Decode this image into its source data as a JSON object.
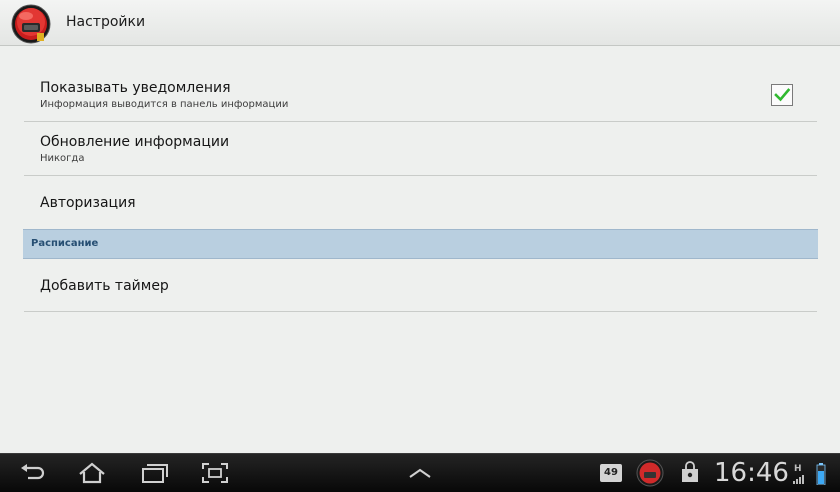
{
  "action_bar": {
    "title": "Настройки",
    "app_icon": "app-logo-icon"
  },
  "preferences": {
    "show_notifications": {
      "title": "Показывать уведомления",
      "summary": "Информация выводится в панель информации",
      "checked": true
    },
    "update_info": {
      "title": "Обновление информации",
      "summary": "Никогда"
    },
    "authorization": {
      "title": "Авторизация"
    },
    "schedule_category": {
      "label": "Расписание"
    },
    "add_timer": {
      "title": "Добавить таймер"
    }
  },
  "system_bar": {
    "back_icon": "back-icon",
    "home_icon": "home-icon",
    "recent_icon": "recent-apps-icon",
    "screenshot_icon": "screenshot-icon",
    "up_icon": "chevron-up-icon",
    "notification_badge": "49",
    "clock": "16:46",
    "network_label": "H"
  },
  "colors": {
    "accent_check": "#2fb82f",
    "category_bg": "#b9cfe0",
    "category_text": "#274f73"
  }
}
